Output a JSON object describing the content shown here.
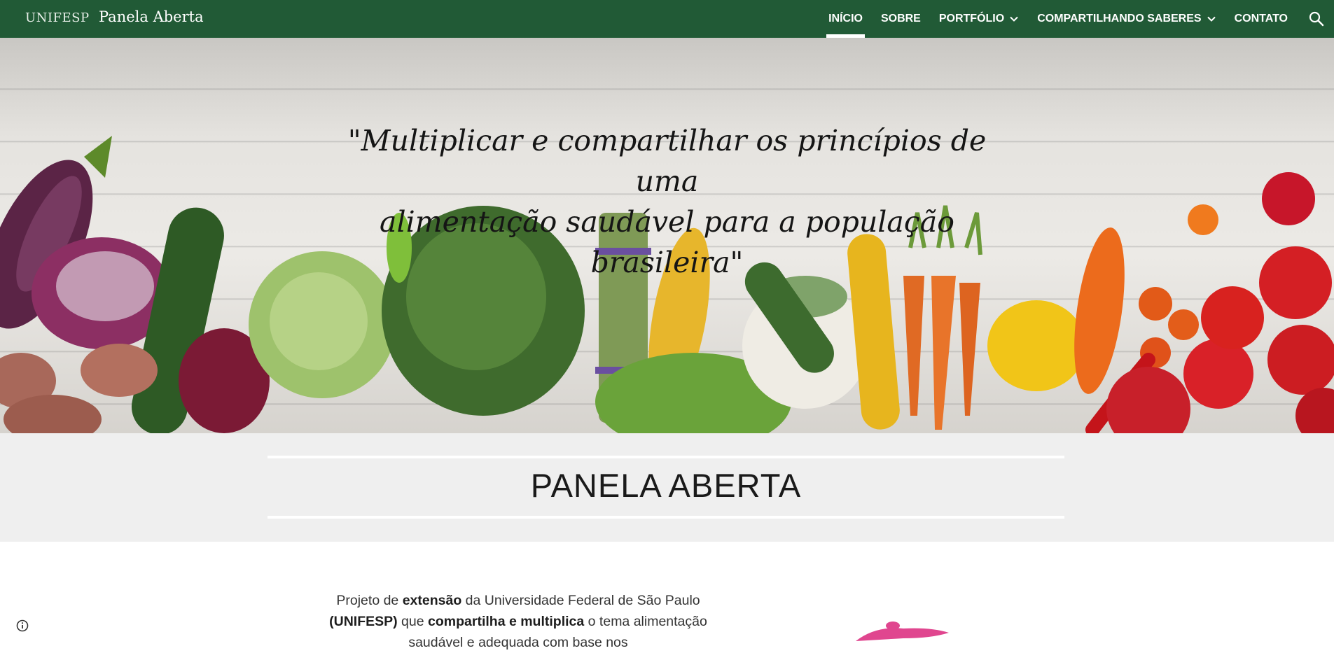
{
  "header": {
    "org_name": "UNIFESP",
    "site_title": "Panela Aberta",
    "nav": [
      {
        "label": "INÍCIO",
        "active": true,
        "has_menu": false
      },
      {
        "label": "SOBRE",
        "active": false,
        "has_menu": false
      },
      {
        "label": "PORTFÓLIO",
        "active": false,
        "has_menu": true
      },
      {
        "label": "COMPARTILHANDO SABERES",
        "active": false,
        "has_menu": true
      },
      {
        "label": "CONTATO",
        "active": false,
        "has_menu": false
      }
    ],
    "search_icon": "search-icon"
  },
  "hero": {
    "quote_line1": "\"Multiplicar e compartilhar os princípios de uma",
    "quote_line2": "alimentação saudável para a população brasileira\""
  },
  "main": {
    "title": "PANELA ABERTA",
    "intro_parts": [
      {
        "text": "Projeto de ",
        "bold": false
      },
      {
        "text": "extensão",
        "bold": true
      },
      {
        "text": " da Universidade Federal de São Paulo ",
        "bold": false
      },
      {
        "text": "(UNIFESP)",
        "bold": true
      },
      {
        "text": " que ",
        "bold": false
      },
      {
        "text": "compartilha e multiplica",
        "bold": true
      },
      {
        "text": " o tema alimentação saudável e adequada com base nos",
        "bold": false
      }
    ]
  },
  "footer": {
    "info_icon": "info-icon"
  },
  "colors": {
    "topbar": "#215a36",
    "title_band": "#efefef",
    "logo_accent": "#e0468f"
  }
}
